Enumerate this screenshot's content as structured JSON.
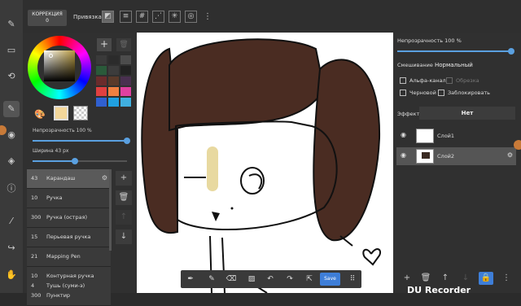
{
  "lefttools": [
    {
      "icon": "edit-icon",
      "glyph": "✎"
    },
    {
      "icon": "select-rect-icon",
      "glyph": "▭"
    },
    {
      "icon": "rotate-icon",
      "glyph": "⟲"
    },
    {
      "icon": "brush-icon",
      "glyph": "✎"
    },
    {
      "icon": "palette-icon",
      "glyph": "◉"
    },
    {
      "icon": "layers-icon",
      "glyph": "◈"
    },
    {
      "icon": "info-icon",
      "glyph": "ⓘ"
    },
    {
      "icon": "eyedropper-icon",
      "glyph": "⁄"
    },
    {
      "icon": "share-icon",
      "glyph": "↪"
    },
    {
      "icon": "hand-icon",
      "glyph": "✋"
    }
  ],
  "topbar": {
    "correction_label": "КОРРЕКЦИЯ",
    "correction_value": "0",
    "snap_label": "Привязка",
    "snap_icons": [
      "snap-off-icon",
      "snap-parallel-icon",
      "snap-grid-icon",
      "snap-diagonal-icon",
      "snap-radial-icon",
      "snap-circle-icon"
    ],
    "more_glyph": "⋮"
  },
  "color": {
    "main_color": "#f3d79a",
    "swatches": [
      "#3a3a3a",
      "#2b2b2b",
      "#4c4c4c",
      "#2a5a3a",
      "#3c3c3c",
      "#222222",
      "#6b2c2c",
      "#5a3a2a",
      "#4a3050",
      "#e04040",
      "#f08040",
      "#e040a0",
      "#3060d0",
      "#20a0e0",
      "#40b0e0"
    ],
    "brush_opacity_label": "Непрозрачность 100 %",
    "brush_opacity": 100,
    "brush_width_label": "Ширина 43 px",
    "brush_width": 43
  },
  "brushes": [
    {
      "size": "43",
      "name": "Карандаш",
      "selected": true
    },
    {
      "size": "10",
      "name": "Ручка"
    },
    {
      "size": "300",
      "name": "Ручка (острая)"
    },
    {
      "size": "15",
      "name": "Перьевая ручка"
    },
    {
      "size": "21",
      "name": "Mapping Pen"
    },
    {
      "size": "10",
      "name": "Контурная ручка"
    },
    {
      "size": "300",
      "name": "Пунктир"
    },
    {
      "size": "4",
      "name": "Тушь (суми-э)"
    }
  ],
  "bottombar": {
    "tools": [
      "pen-icon",
      "brush-icon",
      "eraser-icon",
      "clear-icon",
      "undo-icon",
      "redo-icon",
      "export-icon"
    ],
    "save_label": "Save",
    "grid_icon": "grid-icon"
  },
  "layer_panel": {
    "opacity_label": "Непрозрачность 100 %",
    "opacity": 100,
    "blend_label": "Смешивание",
    "blend_value": "Нормальный",
    "alpha_label": "Альфа-канал",
    "clip_label": "Обрезка",
    "draft_label": "Черновой",
    "lock_label": "Заблокировать",
    "effect_label": "Эффект",
    "effect_value": "Нет",
    "layers": [
      {
        "name": "Слой1",
        "selected": false
      },
      {
        "name": "Слой2",
        "selected": true
      }
    ]
  },
  "watermark": "DU Recorder"
}
